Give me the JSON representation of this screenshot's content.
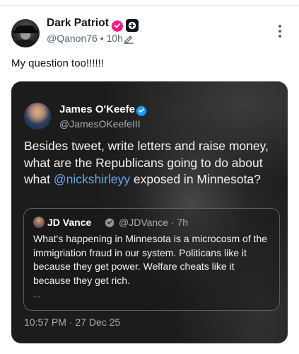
{
  "post": {
    "author_name": "Dark Patriot",
    "author_handle": "@Qanon76",
    "separator": "•",
    "age": "10h",
    "text": "My question too!!!!!!"
  },
  "quoted": {
    "author_name": "James O'Keefe",
    "author_handle": "@JamesOKeefeIII",
    "text_before": "Besides tweet, write letters and raise money, what are the Republicans going to do about what ",
    "mention": "@nickshirleyy",
    "text_after": " exposed in Minnesota?",
    "timestamp": "10:57 PM · 27 Dec 25",
    "inner": {
      "author_name": "JD Vance",
      "author_handle": "@JDVance · 7h",
      "text": "What's happening in Minnesota is a microcosm of the immigriation fraud in our system. Politicans like it because they get power. Welfare cheats like it because they get rich.",
      "ellipsis": "..."
    }
  },
  "icons": {
    "verified": "verified-badge-icon",
    "affiliate": "plus-square-icon",
    "edit": "pencil-edit-icon",
    "more": "more-vertical-icon"
  },
  "colors": {
    "verified_red": "#f91880",
    "verified_blue": "#1d9bf0",
    "mention_blue": "#69a6e6"
  }
}
